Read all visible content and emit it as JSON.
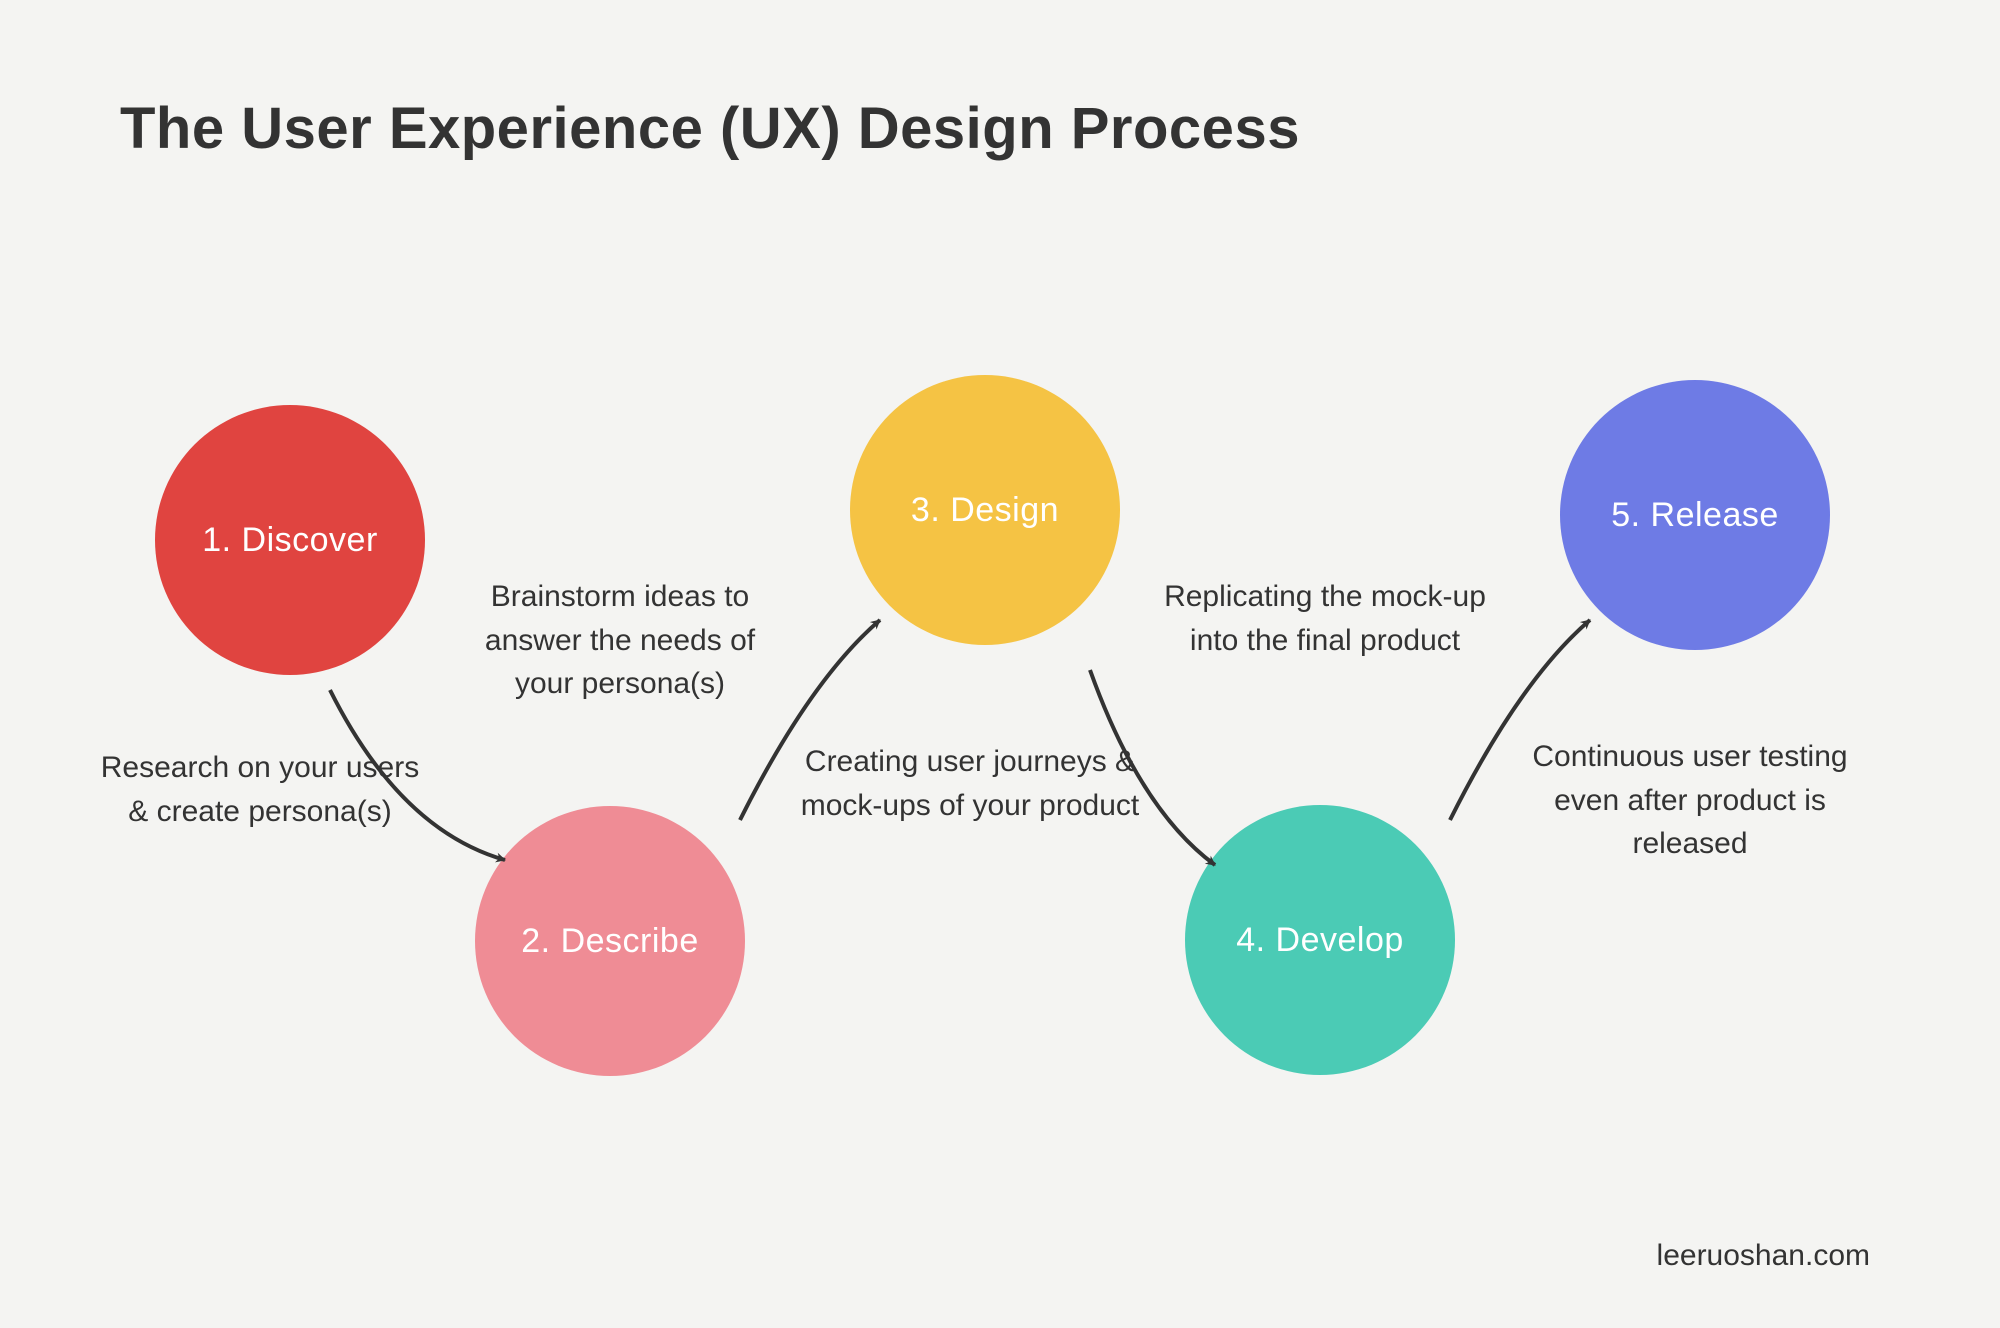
{
  "title": "The User Experience (UX) Design Process",
  "attribution": "leeruoshan.com",
  "steps": {
    "s1": {
      "label": "1. Discover",
      "caption": "Research on your users & create persona(s)"
    },
    "s2": {
      "label": "2. Describe",
      "caption": "Brainstorm ideas to answer the needs of your persona(s)"
    },
    "s3": {
      "label": "3. Design",
      "caption": "Creating  user journeys & mock-ups of your product"
    },
    "s4": {
      "label": "4. Develop",
      "caption": "Replicating the mock-up into the final product"
    },
    "s5": {
      "label": "5. Release",
      "caption": "Continuous user testing even after product is released"
    }
  },
  "colors": {
    "s1": "#e04440",
    "s2": "#ef8c95",
    "s3": "#f5c344",
    "s4": "#4bcbb5",
    "s5": "#6e7be5"
  }
}
